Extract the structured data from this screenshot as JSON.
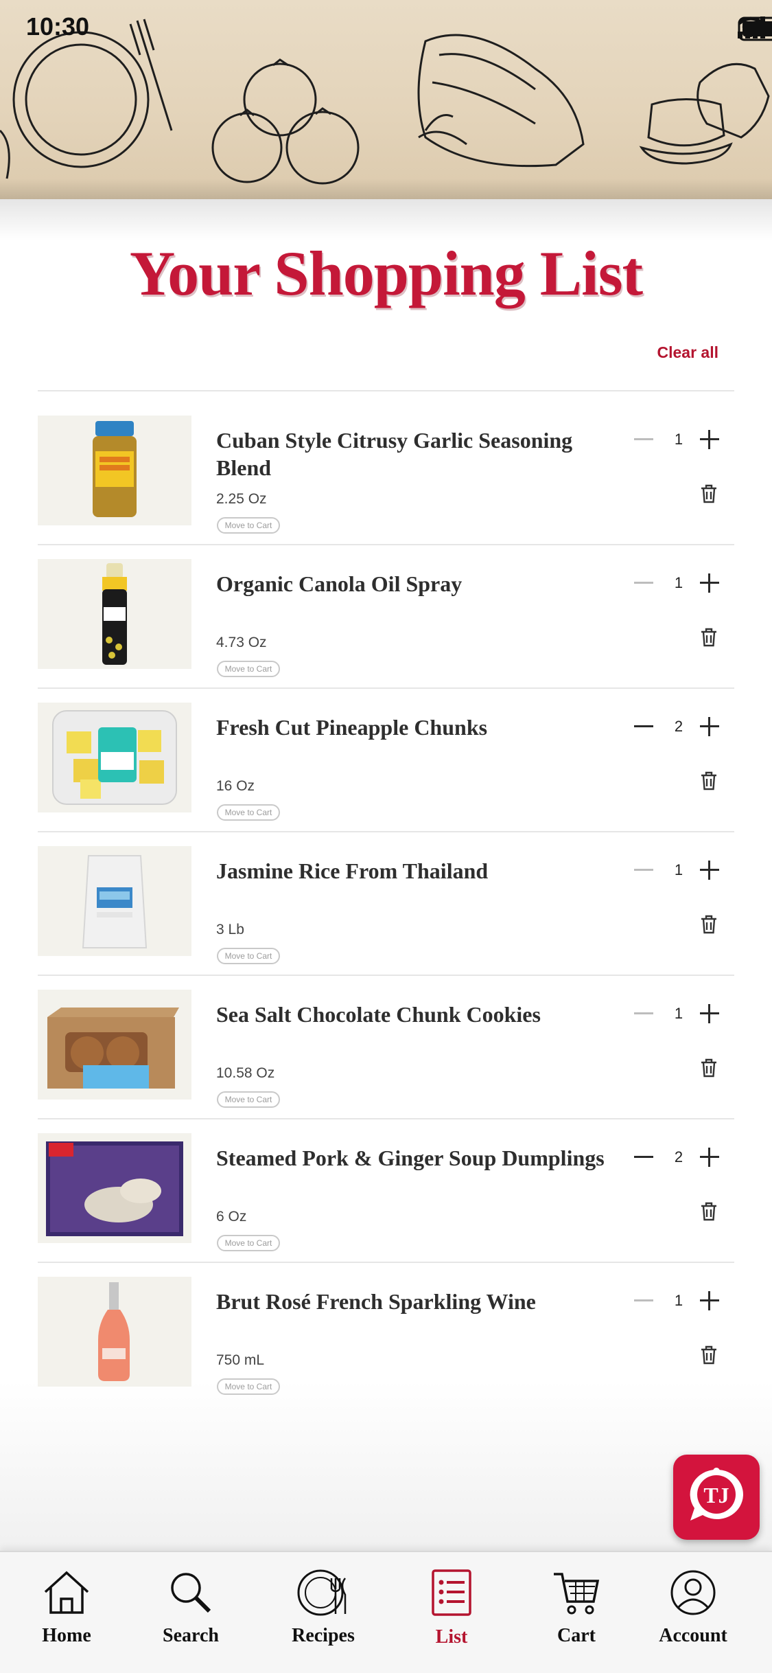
{
  "status_bar": {
    "time": "10:30"
  },
  "page_title": "Your Shopping List",
  "clear_all_label": "Clear all",
  "move_to_cart_label": "Move to Cart",
  "items": [
    {
      "name": "Cuban Style Citrusy Garlic Seasoning Blend",
      "size": "2.25 Oz",
      "qty": "1",
      "image": "seasoning-jar"
    },
    {
      "name": "Organic Canola Oil Spray",
      "size": "4.73 Oz",
      "qty": "1",
      "image": "oil-spray-can"
    },
    {
      "name": "Fresh Cut Pineapple Chunks",
      "size": "16 Oz",
      "qty": "2",
      "image": "pineapple-container"
    },
    {
      "name": "Jasmine Rice From Thailand",
      "size": "3 Lb",
      "qty": "1",
      "image": "rice-bag"
    },
    {
      "name": "Sea Salt Chocolate Chunk Cookies",
      "size": "10.58 Oz",
      "qty": "1",
      "image": "cookie-box"
    },
    {
      "name": "Steamed Pork & Ginger Soup Dumplings",
      "size": "6 Oz",
      "qty": "2",
      "image": "dumpling-box"
    },
    {
      "name": "Brut Rosé French Sparkling Wine",
      "size": "750 mL",
      "qty": "1",
      "image": "wine-bottle"
    }
  ],
  "chat_button": {
    "icon": "tj-chat-icon"
  },
  "tabs": [
    {
      "label": "Home",
      "icon": "home-icon"
    },
    {
      "label": "Search",
      "icon": "search-icon"
    },
    {
      "label": "Recipes",
      "icon": "recipes-icon"
    },
    {
      "label": "List",
      "icon": "list-icon",
      "active": true
    },
    {
      "label": "Cart",
      "icon": "cart-icon"
    },
    {
      "label": "Account",
      "icon": "account-icon"
    }
  ],
  "colors": {
    "accent": "#c41838",
    "active_tab": "#b4142f",
    "banner": "#e3d3b9"
  }
}
